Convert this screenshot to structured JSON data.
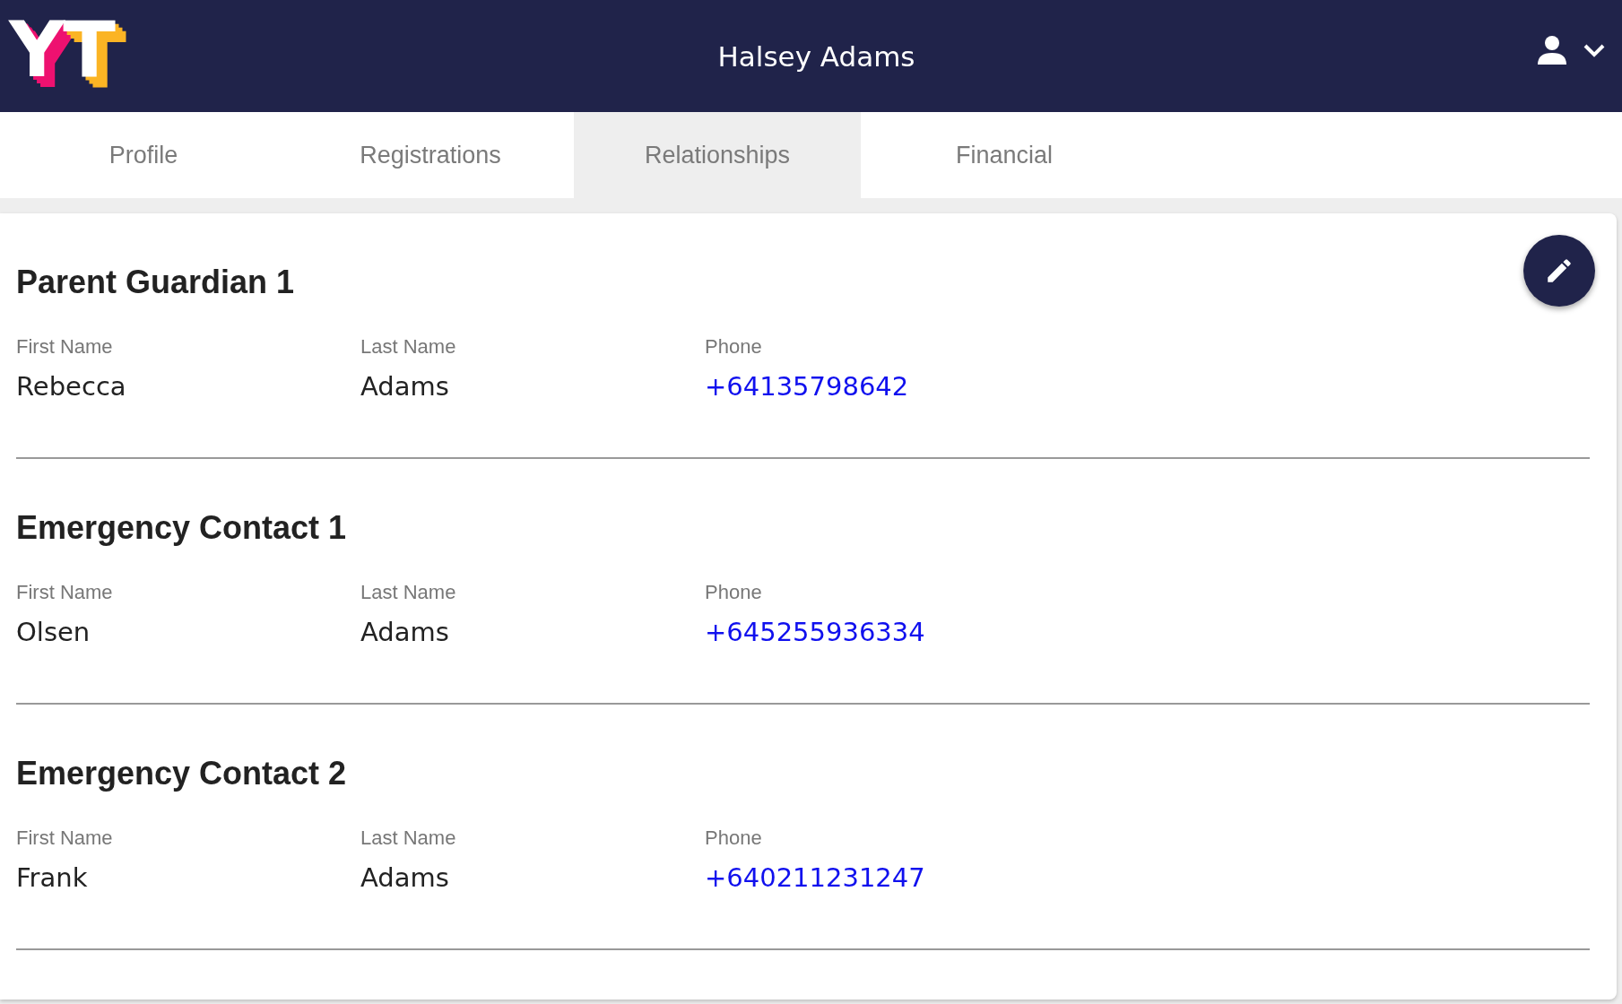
{
  "header": {
    "logo": [
      "Y",
      "T"
    ],
    "title": "Halsey Adams"
  },
  "tabs": [
    {
      "label": "Profile",
      "selected": false
    },
    {
      "label": "Registrations",
      "selected": false
    },
    {
      "label": "Relationships",
      "selected": true
    },
    {
      "label": "Financial",
      "selected": false
    }
  ],
  "sections": [
    {
      "title": "Parent Guardian 1",
      "fields": [
        {
          "label": "First Name",
          "value": "Rebecca",
          "kind": "text"
        },
        {
          "label": "Last Name",
          "value": "Adams",
          "kind": "text"
        },
        {
          "label": "Phone",
          "value": "+64135798642",
          "kind": "phone"
        }
      ]
    },
    {
      "title": "Emergency Contact 1",
      "fields": [
        {
          "label": "First Name",
          "value": "Olsen",
          "kind": "text"
        },
        {
          "label": "Last Name",
          "value": "Adams",
          "kind": "text"
        },
        {
          "label": "Phone",
          "value": "+645255936334",
          "kind": "phone"
        }
      ]
    },
    {
      "title": "Emergency Contact 2",
      "fields": [
        {
          "label": "First Name",
          "value": "Frank",
          "kind": "text"
        },
        {
          "label": "Last Name",
          "value": "Adams",
          "kind": "text"
        },
        {
          "label": "Phone",
          "value": "+640211231247",
          "kind": "phone"
        }
      ]
    }
  ]
}
